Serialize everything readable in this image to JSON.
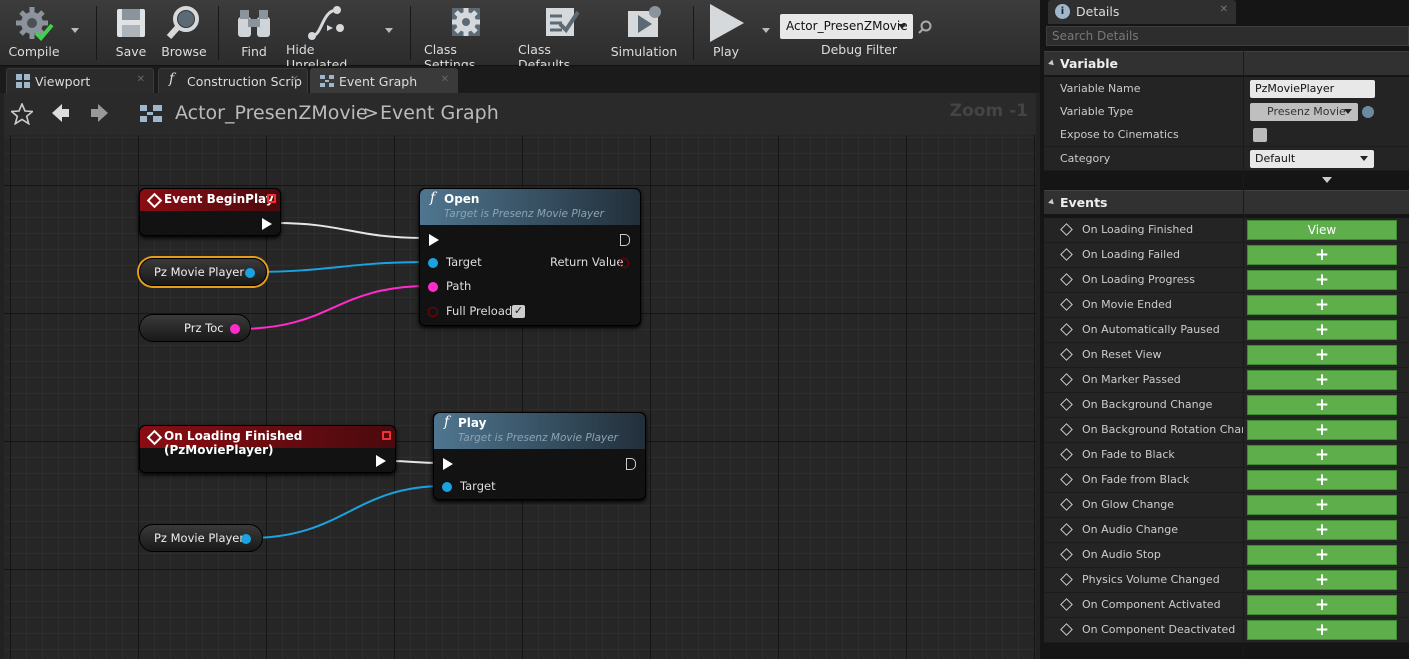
{
  "toolbar": {
    "compile": "Compile",
    "save": "Save",
    "browse": "Browse",
    "find": "Find",
    "hide_unrelated": "Hide Unrelated",
    "class_settings": "Class Settings",
    "class_defaults": "Class Defaults",
    "simulation": "Simulation",
    "play": "Play",
    "debug_object": "Actor_PresenZMovie",
    "debug_filter": "Debug Filter"
  },
  "tabs": [
    {
      "label": "Viewport"
    },
    {
      "label": "Construction Scrip"
    },
    {
      "label": "Event Graph"
    }
  ],
  "breadcrumb": {
    "blueprint": "Actor_PresenZMovie",
    "separator": ">",
    "graph": "Event Graph",
    "zoom": "Zoom -1"
  },
  "graph": {
    "event_beginplay": {
      "title": "Event BeginPlay"
    },
    "open_node": {
      "title": "Open",
      "subtitle": "Target is Presenz Movie Player",
      "target": "Target",
      "path": "Path",
      "full_preload": "Full Preload",
      "return_value": "Return Value"
    },
    "getter1": "Pz Movie Player",
    "getter_toc": "Prz Toc",
    "event_loading": {
      "title": "On Loading Finished (PzMoviePlayer)"
    },
    "play_node": {
      "title": "Play",
      "subtitle": "Target is Presenz Movie Player",
      "target": "Target"
    },
    "getter2": "Pz Movie Player"
  },
  "details": {
    "tab": "Details",
    "search_placeholder": "Search Details",
    "variable_section": "Variable",
    "variable_name_label": "Variable Name",
    "variable_name": "PzMoviePlayer",
    "variable_type_label": "Variable Type",
    "variable_type": "Presenz Movie",
    "expose_label": "Expose to Cinematics",
    "category_label": "Category",
    "category": "Default",
    "events_section": "Events",
    "view_label": "View",
    "add_label": "+",
    "events": [
      "On Loading Finished",
      "On Loading Failed",
      "On Loading Progress",
      "On Movie Ended",
      "On Automatically Paused",
      "On Reset View",
      "On Marker Passed",
      "On Background Change",
      "On Background Rotation Change",
      "On Fade to Black",
      "On Fade from Black",
      "On Glow Change",
      "On Audio Change",
      "On Audio Stop",
      "Physics Volume Changed",
      "On Component Activated",
      "On Component Deactivated"
    ]
  },
  "colors": {
    "exec": "#ffffff",
    "object_pin": "#1aa3e0",
    "string_pin": "#ff2ccb",
    "bool_pin": "#8c0000",
    "event_header": "#8a0d13",
    "function_header": "#4f7690",
    "add_button": "#5fae4c"
  }
}
